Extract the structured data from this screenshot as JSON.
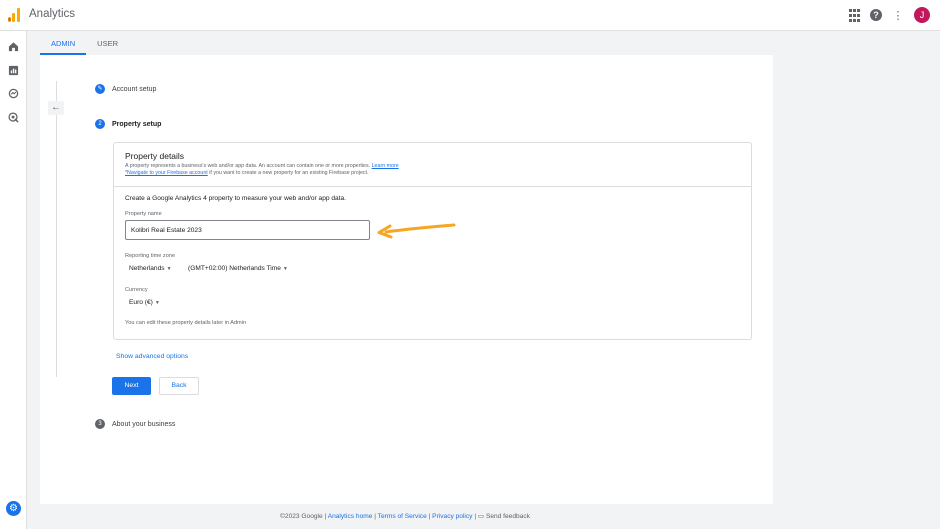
{
  "app": {
    "title": "Analytics",
    "avatar_letter": "J"
  },
  "header_icons": [
    "apps-grid-icon",
    "help-icon",
    "more-vert-icon"
  ],
  "tabs": [
    {
      "label": "ADMIN",
      "active": true
    },
    {
      "label": "USER",
      "active": false
    }
  ],
  "steps": [
    {
      "number": "1",
      "label": "Account setup",
      "state": "done"
    },
    {
      "number": "2",
      "label": "Property setup",
      "state": "active"
    },
    {
      "number": "3",
      "label": "About your business",
      "state": "pending"
    }
  ],
  "property_details": {
    "title": "Property details",
    "desc_line1": "A property represents a business's web and/or app data. An account can contain one or more properties.",
    "learn_more": "Learn more",
    "firebase_link": "*Navigate to your Firebase account",
    "desc_line2": " if you want to create a new property for an existing Firebase project.",
    "intro": "Create a Google Analytics 4 property to measure your web and/or app data.",
    "property_name_label": "Property name",
    "property_name_value": "Kolibri Real Estate 2023",
    "timezone_label": "Reporting time zone",
    "country": "Netherlands",
    "timezone": "(GMT+02:00) Netherlands Time",
    "currency_label": "Currency",
    "currency": "Euro (€)",
    "note": "You can edit these property details later in Admin"
  },
  "actions": {
    "advanced": "Show advanced options",
    "next": "Next",
    "back": "Back"
  },
  "footer": {
    "copyright": "©2023 Google",
    "analytics_home": "Analytics home",
    "terms": "Terms of Service",
    "privacy": "Privacy policy",
    "feedback": "Send feedback"
  },
  "colors": {
    "accent": "#1a73e8",
    "arrow": "#f5a623",
    "avatar": "#c2185b"
  }
}
